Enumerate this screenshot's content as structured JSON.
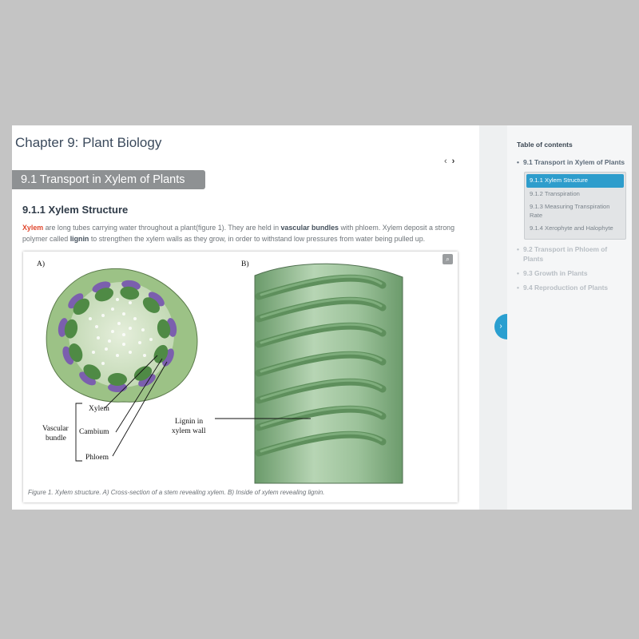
{
  "chapter": {
    "title": "Chapter 9: Plant Biology"
  },
  "nav": {
    "prev": "‹",
    "next": "›"
  },
  "section": {
    "title": "9.1 Transport in Xylem of Plants"
  },
  "subsection": {
    "title": "9.1.1 Xylem Structure"
  },
  "paragraph": {
    "term_xylem": "Xylem",
    "part1": " are long tubes carrying water throughout a plant(figure 1). They are held in ",
    "term_bundles": "vascular bundles",
    "part2": " with phloem. Xylem deposit a strong polymer called ",
    "term_lignin": "lignin",
    "part3": " to strengthen the xylem walls as they grow, in order to withstand low pressures from water being pulled up."
  },
  "figure": {
    "label_a": "A)",
    "label_b": "B)",
    "xylem": "Xylem",
    "cambium": "Cambium",
    "phloem": "Phloem",
    "vascular_1": "Vascular",
    "vascular_2": "bundle",
    "lignin_1": "Lignin in",
    "lignin_2": "xylem wall",
    "zoom_icon": "magnifier",
    "caption": "Figure 1. Xylem structure. A) Cross-section of a stem revealing xylem. B) Inside of xylem revealing lignin."
  },
  "toc": {
    "title": "Table of contents",
    "items": [
      {
        "label": "9.1 Transport in Xylem of Plants",
        "state": "active"
      },
      {
        "label": "9.2 Transport in Phloem of Plants",
        "state": "inactive"
      },
      {
        "label": "9.3 Growth in Plants",
        "state": "inactive"
      },
      {
        "label": "9.4 Reproduction of Plants",
        "state": "inactive"
      }
    ],
    "subitems": [
      {
        "label": "9.1.1 Xylem Structure",
        "selected": true
      },
      {
        "label": "9.1.2 Transpiration",
        "selected": false
      },
      {
        "label": "9.1.3 Measuring Transpiration Rate",
        "selected": false
      },
      {
        "label": "9.1.4 Xerophyte and Halophyte",
        "selected": false
      }
    ]
  },
  "colors": {
    "accent": "#2e9dcc",
    "banner": "#8e9193",
    "highlight": "#e0462c"
  }
}
